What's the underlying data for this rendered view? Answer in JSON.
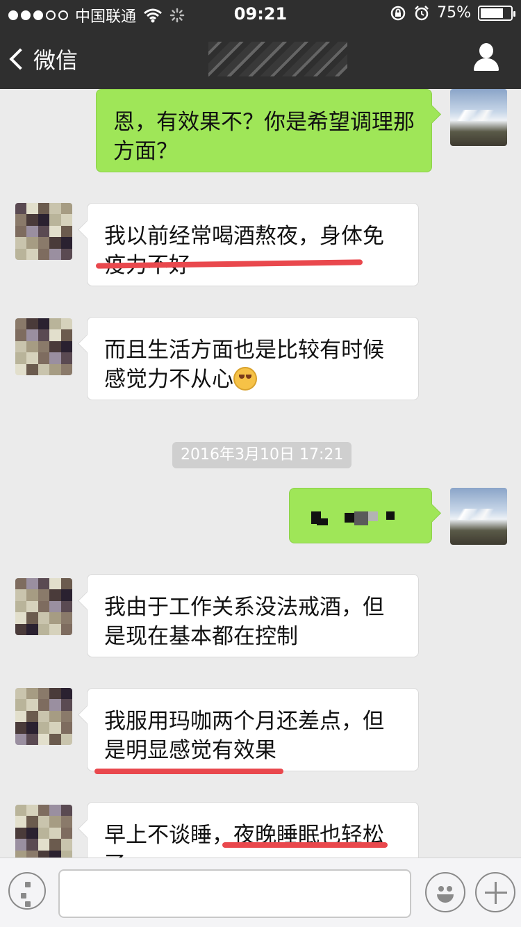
{
  "status_bar": {
    "carrier": "中国联通",
    "time": "09:21",
    "battery": "75%",
    "battery_level": 0.75,
    "icons": [
      "signal-dots-icon",
      "wifi-icon",
      "activity-icon",
      "rotation-lock-icon",
      "alarm-icon",
      "battery-icon"
    ]
  },
  "nav": {
    "back_label": "微信",
    "title": "",
    "right_icon": "profile-icon"
  },
  "messages": [
    {
      "sender": "self",
      "text": "恩，有效果不？你是希望调理那方面？"
    },
    {
      "sender": "other",
      "text": "我以前经常喝酒熬夜，身体免疫力不好",
      "highlighted": "疫力不好"
    },
    {
      "sender": "other",
      "text": "而且生活方面也是比较有时候感觉力不从心",
      "emoji": "dizzy-face-emoji"
    },
    {
      "sender": "self",
      "text": ""
    },
    {
      "sender": "other",
      "text": "我由于工作关系没法戒酒，但是现在基本都在控制"
    },
    {
      "sender": "other",
      "text": "我服用玛咖两个月还差点，但是明显感觉有效果",
      "highlighted": "是明显感觉有效果"
    },
    {
      "sender": "other",
      "text": "早上不谈睡，夜晚睡眠也轻松了",
      "highlighted": "夜晚睡眠也轻松"
    }
  ],
  "timestamp": "2016年3月10日 17:21",
  "input_bar": {
    "placeholder": "",
    "icons": [
      "voice-icon",
      "emoji-icon",
      "plus-icon"
    ]
  },
  "colors": {
    "nav_bg": "#2f2f2f",
    "chat_bg": "#ebebeb",
    "self_bubble": "#9fe658",
    "other_bubble": "#ffffff",
    "underline": "#e9484d"
  }
}
